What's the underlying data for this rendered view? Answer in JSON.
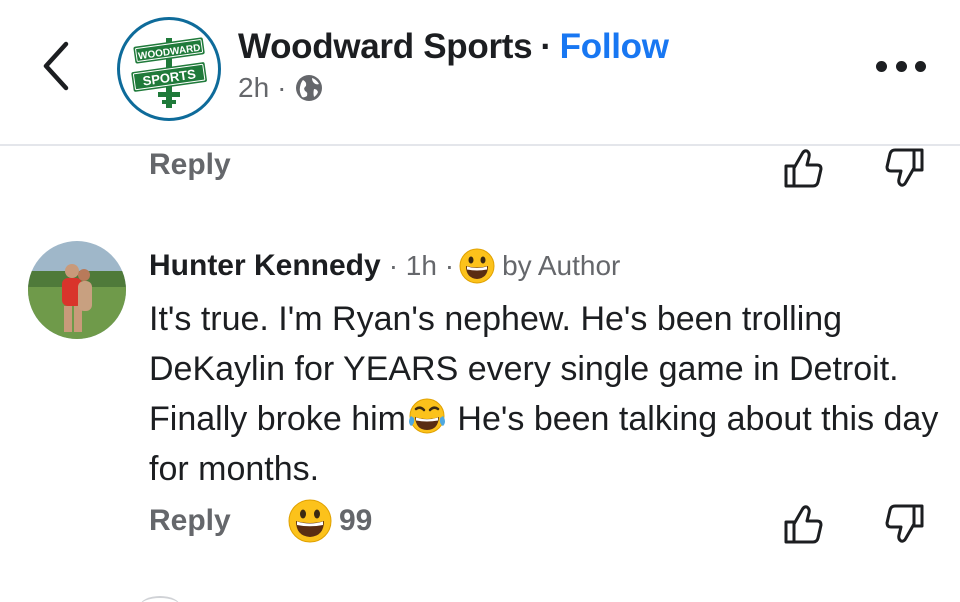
{
  "header": {
    "back_icon": "chevron-left-icon",
    "page_logo_lines": [
      "WOODWARD",
      "SPORTS"
    ],
    "page_name": "Woodward Sports",
    "separator": "·",
    "follow_label": "Follow",
    "post_time": "2h",
    "meta_separator": "·",
    "audience_icon": "globe-icon",
    "more_icon": "more-options-icon"
  },
  "previous_comment": {
    "reply_label": "Reply",
    "like_icon": "thumbs-up-icon",
    "dislike_icon": "thumbs-down-icon"
  },
  "comment": {
    "author": "Hunter Kennedy",
    "time": "· 1h ·",
    "badge_emoji": "grinning-face-emoji",
    "badge_label": "by Author",
    "text_part1": "It's true. I'm Ryan's nephew. He's been trolling DeKaylin for YEARS every single game in Detroit. Finally broke him",
    "inline_emoji": "tears-of-joy-emoji",
    "text_part2": " He's been talking about this day for months.",
    "reply_label": "Reply",
    "reaction_emoji": "grinning-face-emoji",
    "reaction_count": "99",
    "like_icon": "thumbs-up-icon",
    "dislike_icon": "thumbs-down-icon"
  },
  "colors": {
    "link": "#1877f2",
    "secondary_text": "#65676b",
    "primary_text": "#1c1e21",
    "logo_green": "#1f7a3a",
    "logo_ring": "#0e6b9a"
  }
}
